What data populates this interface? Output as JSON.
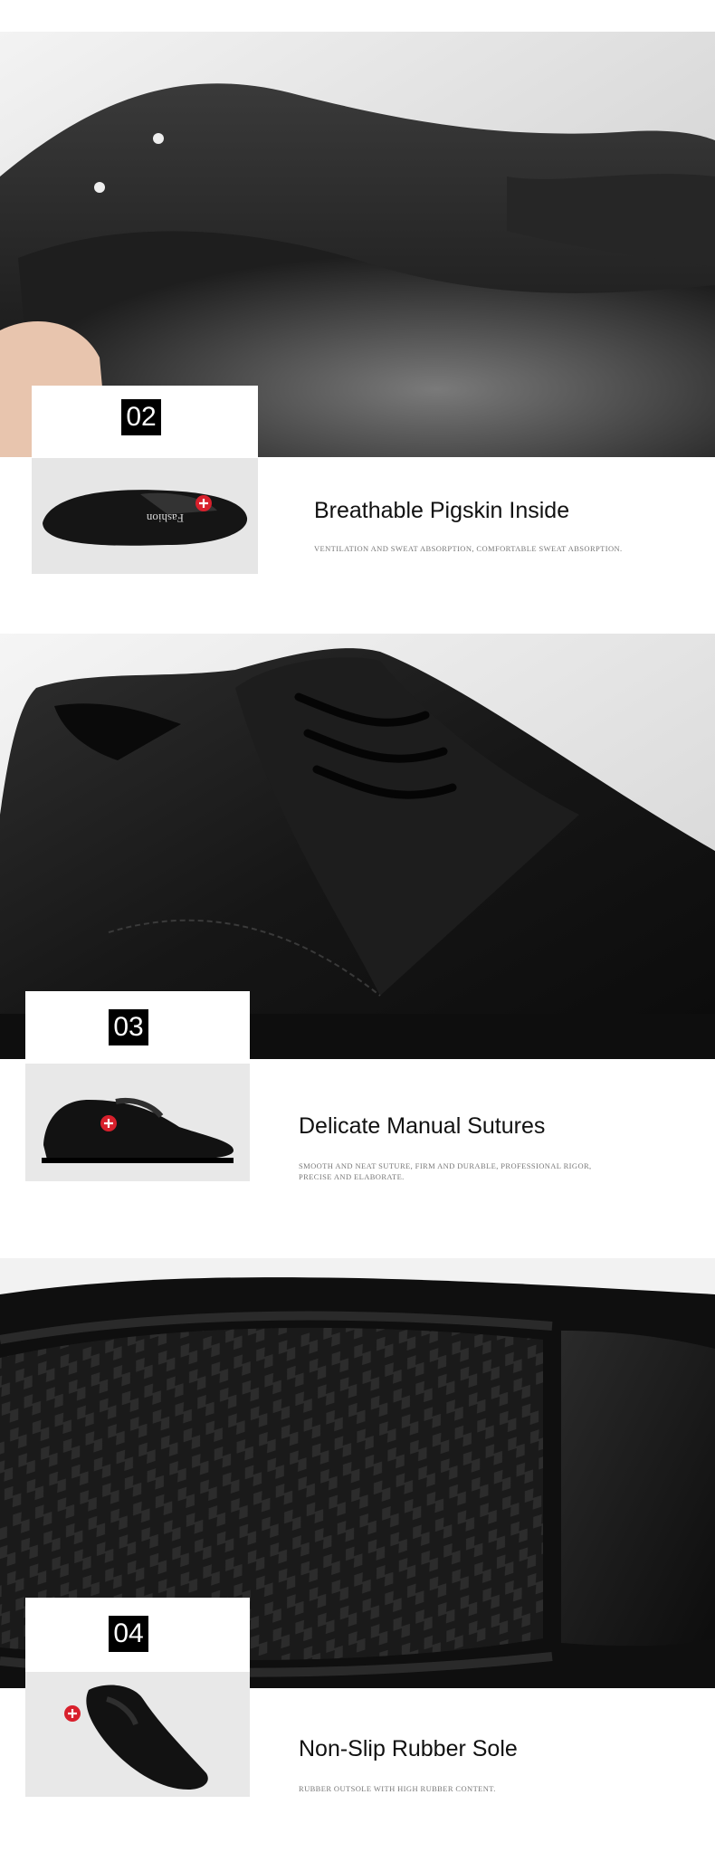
{
  "sections": [
    {
      "number": "02",
      "title": "Breathable Pigskin Inside",
      "subtitle": "VENTILATION AND SWEAT ABSORPTION, COMFORTABLE SWEAT ABSORPTION.",
      "thumb_label": "Fashion"
    },
    {
      "number": "03",
      "title": "Delicate Manual Sutures",
      "subtitle_lines": [
        "SMOOTH AND NEAT SUTURE, FIRM AND DURABLE, PROFESSIONAL RIGOR,",
        "PRECISE AND ELABORATE."
      ]
    },
    {
      "number": "04",
      "title": "Non-Slip Rubber Sole",
      "subtitle": "RUBBER OUTSOLE WITH HIGH RUBBER CONTENT."
    }
  ],
  "colors": {
    "badge_bg": "#000000",
    "badge_text": "#ffffff",
    "plus_marker": "#d8202c"
  }
}
